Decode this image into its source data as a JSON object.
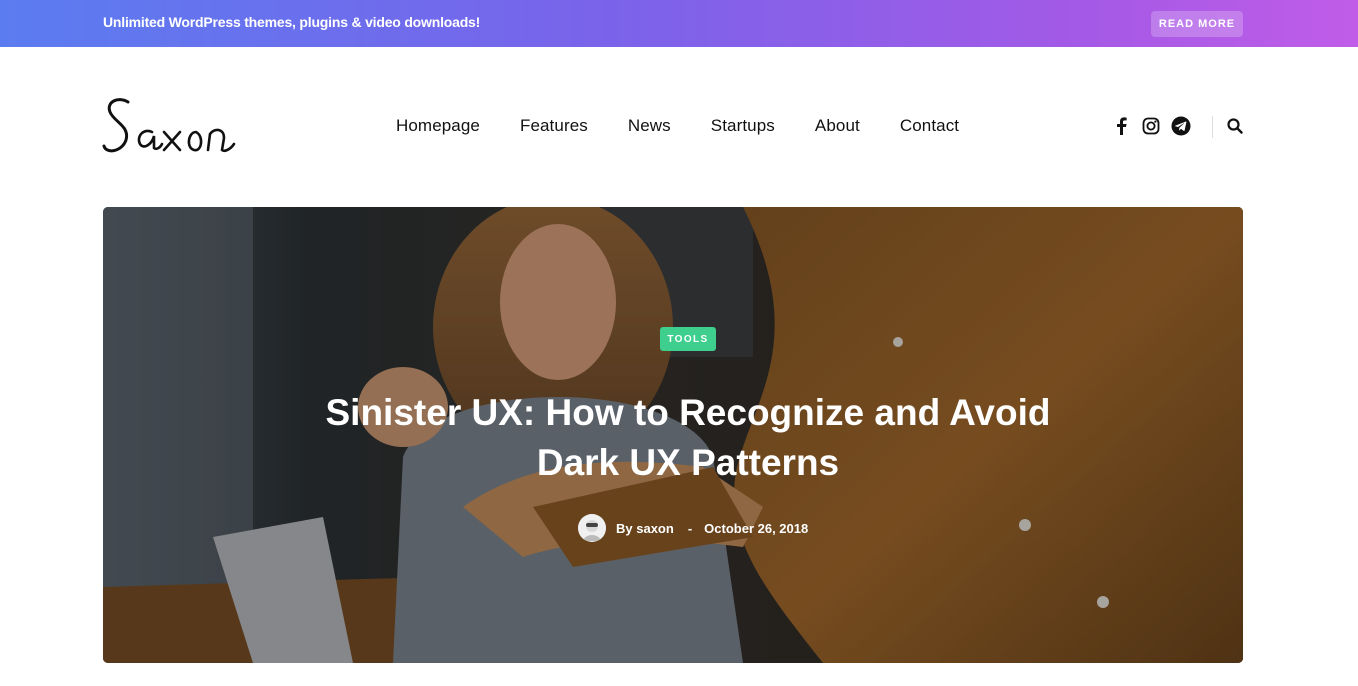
{
  "topbar": {
    "message": "Unlimited WordPress themes, plugins & video downloads!",
    "button_label": "READ MORE"
  },
  "header": {
    "logo_text": "Saxon",
    "nav": [
      {
        "label": "Homepage"
      },
      {
        "label": "Features"
      },
      {
        "label": "News"
      },
      {
        "label": "Startups"
      },
      {
        "label": "About"
      },
      {
        "label": "Contact"
      }
    ],
    "social_icons": [
      "facebook-icon",
      "instagram-icon",
      "telegram-icon"
    ],
    "search_icon": "search-icon"
  },
  "hero": {
    "category": "TOOLS",
    "title": "Sinister UX: How to Recognize and Avoid Dark UX Patterns",
    "author": "By saxon",
    "separator": "-",
    "date": "October 26, 2018"
  },
  "colors": {
    "topbar_start": "#5b7cf0",
    "topbar_end": "#c05ce8",
    "tag": "#3ecf8e"
  }
}
